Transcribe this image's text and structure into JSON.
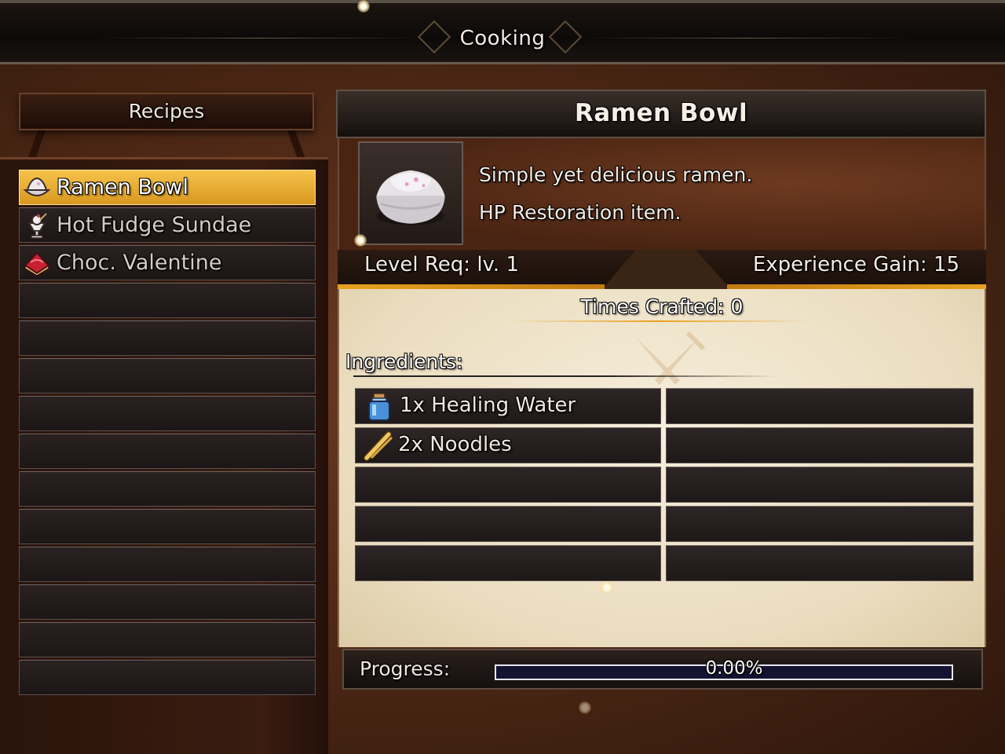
{
  "screen": {
    "title": "Cooking"
  },
  "recipes": {
    "header": "Recipes",
    "items": [
      {
        "label": "Ramen Bowl",
        "icon": "ramen-bowl-icon",
        "selected": true
      },
      {
        "label": "Hot Fudge Sundae",
        "icon": "sundae-icon",
        "selected": false
      },
      {
        "label": "Choc. Valentine",
        "icon": "heart-cake-icon",
        "selected": false
      },
      {
        "label": ""
      },
      {
        "label": ""
      },
      {
        "label": ""
      },
      {
        "label": ""
      },
      {
        "label": ""
      },
      {
        "label": ""
      },
      {
        "label": ""
      },
      {
        "label": ""
      },
      {
        "label": ""
      },
      {
        "label": ""
      },
      {
        "label": ""
      }
    ]
  },
  "detail": {
    "name": "Ramen Bowl",
    "description_line1": "Simple yet delicious ramen.",
    "description_line2": "HP Restoration item.",
    "level_req": "Level Req: lv. 1",
    "experience_gain": "Experience Gain: 15",
    "times_crafted": "Times Crafted: 0",
    "ingredients_label": "Ingredients:",
    "ingredients": [
      {
        "label": "1x Healing Water",
        "icon": "potion-bottle-icon"
      },
      {
        "label": "2x Noodles",
        "icon": "noodles-icon"
      },
      {
        "label": ""
      },
      {
        "label": ""
      },
      {
        "label": ""
      },
      {
        "label": ""
      },
      {
        "label": ""
      },
      {
        "label": ""
      },
      {
        "label": ""
      },
      {
        "label": ""
      }
    ]
  },
  "progress": {
    "label": "Progress:",
    "value_text": "0.00%",
    "value": 0
  },
  "colors": {
    "selected_row": "#e6a82e",
    "accent_gold": "#e8a020",
    "progress_track": "#141432"
  }
}
